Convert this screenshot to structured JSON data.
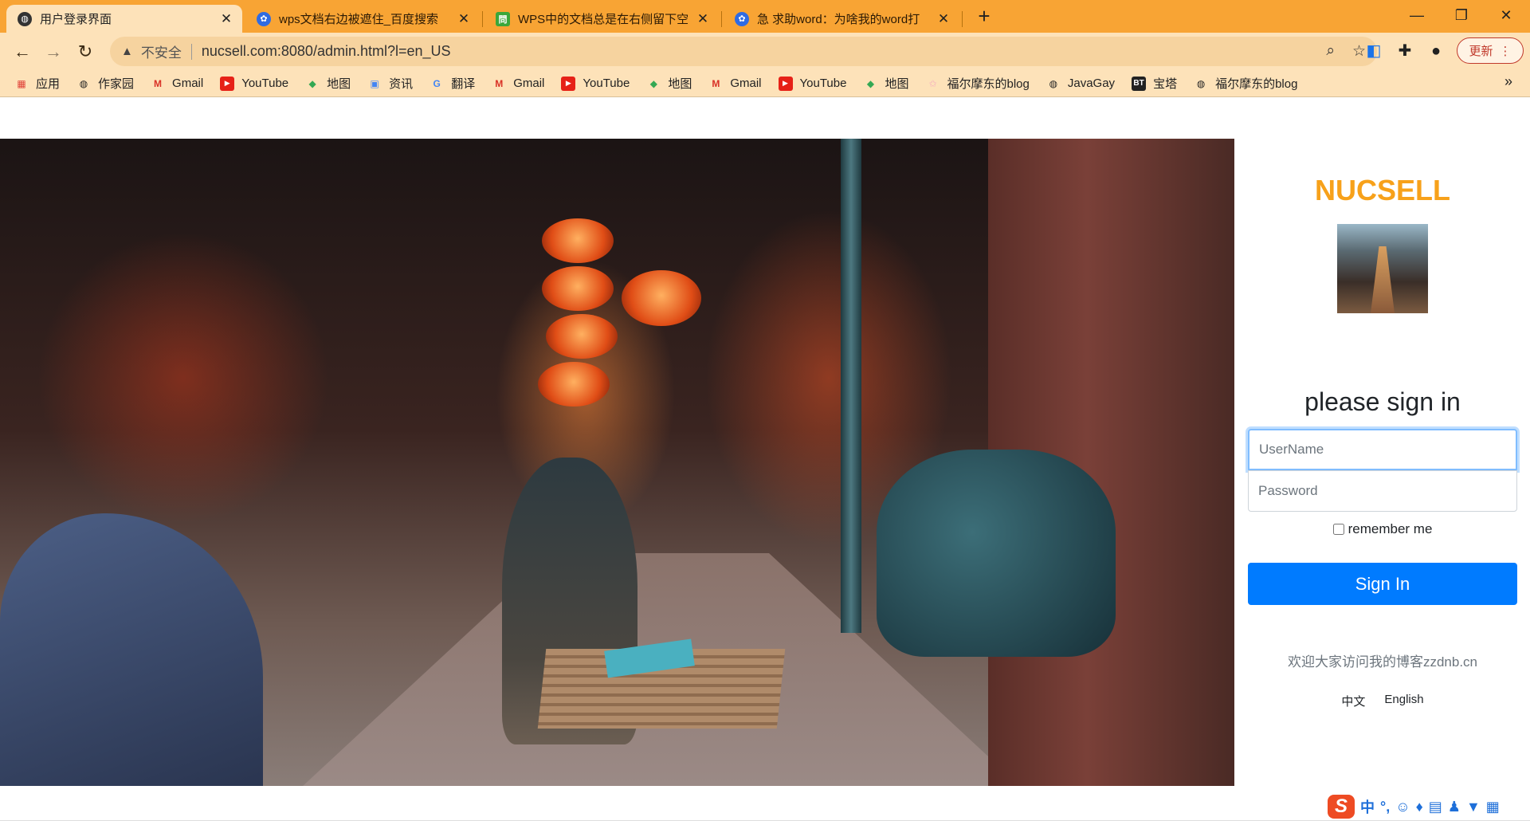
{
  "browser": {
    "tabs": [
      {
        "title": "用户登录界面",
        "active": true,
        "icon": "globe-icon"
      },
      {
        "title": "wps文档右边被遮住_百度搜索",
        "active": false,
        "icon": "baidu-paw-icon"
      },
      {
        "title": "WPS中的文档总是在右侧留下空",
        "active": false,
        "icon": "green-doc-icon"
      },
      {
        "title": "急 求助word：为啥我的word打",
        "active": false,
        "icon": "baidu-paw-icon"
      }
    ],
    "new_tab_symbol": "+",
    "window_controls": {
      "minimize": "—",
      "restore": "❐",
      "close": "✕"
    },
    "address": {
      "warning_icon": "warning-triangle-icon",
      "insecure_label": "不安全",
      "url": "nucsell.com:8080/admin.html?l=en_US"
    },
    "update_button": "更新",
    "bookmarks": [
      {
        "label": "应用",
        "icon": "apps-grid-icon"
      },
      {
        "label": "作家园",
        "icon": "globe-icon"
      },
      {
        "label": "Gmail",
        "icon": "gmail-icon"
      },
      {
        "label": "YouTube",
        "icon": "youtube-icon"
      },
      {
        "label": "地图",
        "icon": "maps-icon"
      },
      {
        "label": "资讯",
        "icon": "news-icon"
      },
      {
        "label": "翻译",
        "icon": "translate-icon"
      },
      {
        "label": "Gmail",
        "icon": "gmail-icon"
      },
      {
        "label": "YouTube",
        "icon": "youtube-icon"
      },
      {
        "label": "地图",
        "icon": "maps-icon"
      },
      {
        "label": "Gmail",
        "icon": "gmail-icon"
      },
      {
        "label": "YouTube",
        "icon": "youtube-icon"
      },
      {
        "label": "地图",
        "icon": "maps-icon"
      },
      {
        "label": "福尔摩东的blog",
        "icon": "star-icon"
      },
      {
        "label": "JavaGay",
        "icon": "globe-icon"
      },
      {
        "label": "宝塔",
        "icon": "bt-icon"
      },
      {
        "label": "福尔摩东的blog",
        "icon": "globe-icon"
      }
    ],
    "bookmarks_more": "»"
  },
  "login": {
    "brand": "NUCSELL",
    "heading": "please sign in",
    "username_placeholder": "UserName",
    "password_placeholder": "Password",
    "remember_label": "remember me",
    "signin_label": "Sign In",
    "welcome_text": "欢迎大家访问我的博客zzdnb.cn",
    "lang_zh": "中文",
    "lang_en": "English"
  },
  "ime": {
    "logo": "S",
    "mode": "中",
    "punct": "°,"
  },
  "colors": {
    "tab_strip": "#f8a434",
    "toolbar": "#fde2b9",
    "brand": "#f7a11a",
    "primary": "#007bff"
  }
}
